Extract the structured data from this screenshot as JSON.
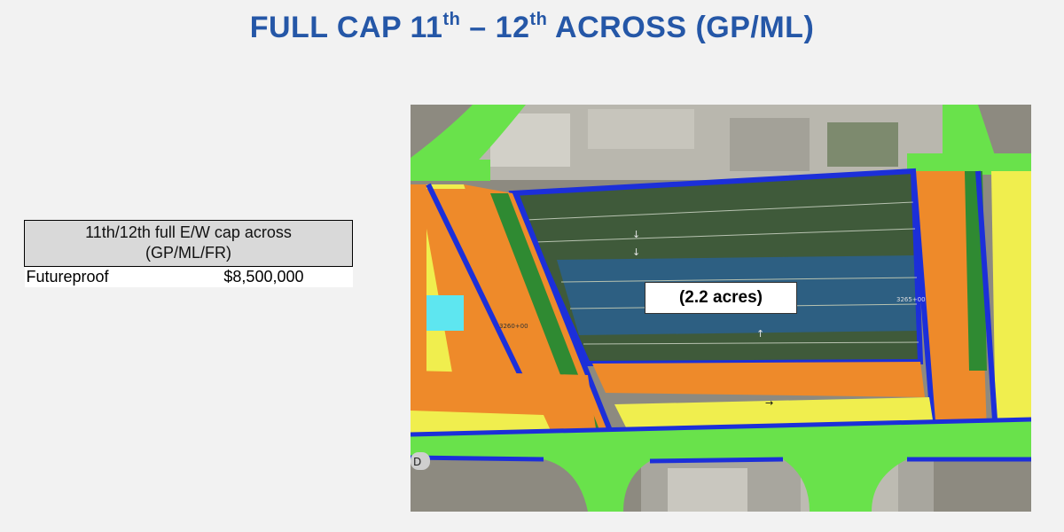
{
  "slide": {
    "title_part1": "FULL CAP 11",
    "title_sup1": "th",
    "title_part2": " – 12",
    "title_sup2": "th",
    "title_part3": " ACROSS (GP/ML)"
  },
  "cost_table": {
    "header_line1": "11th/12th full E/W cap across",
    "header_line2": "(GP/ML/FR)",
    "rows": [
      {
        "label": "Futureproof",
        "value": "$8,500,000"
      }
    ]
  },
  "map": {
    "cap_area_label": "(2.2 acres)",
    "station_left": "3260+00",
    "station_right": "3265+00",
    "edge_label": "D"
  },
  "colors": {
    "title_blue": "#2557a7",
    "cap_green": "#3f5a3a",
    "cap_blue": "#2d5f82",
    "frontage_orange": "#ee8a2a",
    "lane_yellow": "#f0ee4e",
    "street_green": "#69e24b",
    "curb_blue": "#1c2fd9",
    "median_green": "#2f8a32",
    "cyan_lane": "#5ee6f0"
  }
}
